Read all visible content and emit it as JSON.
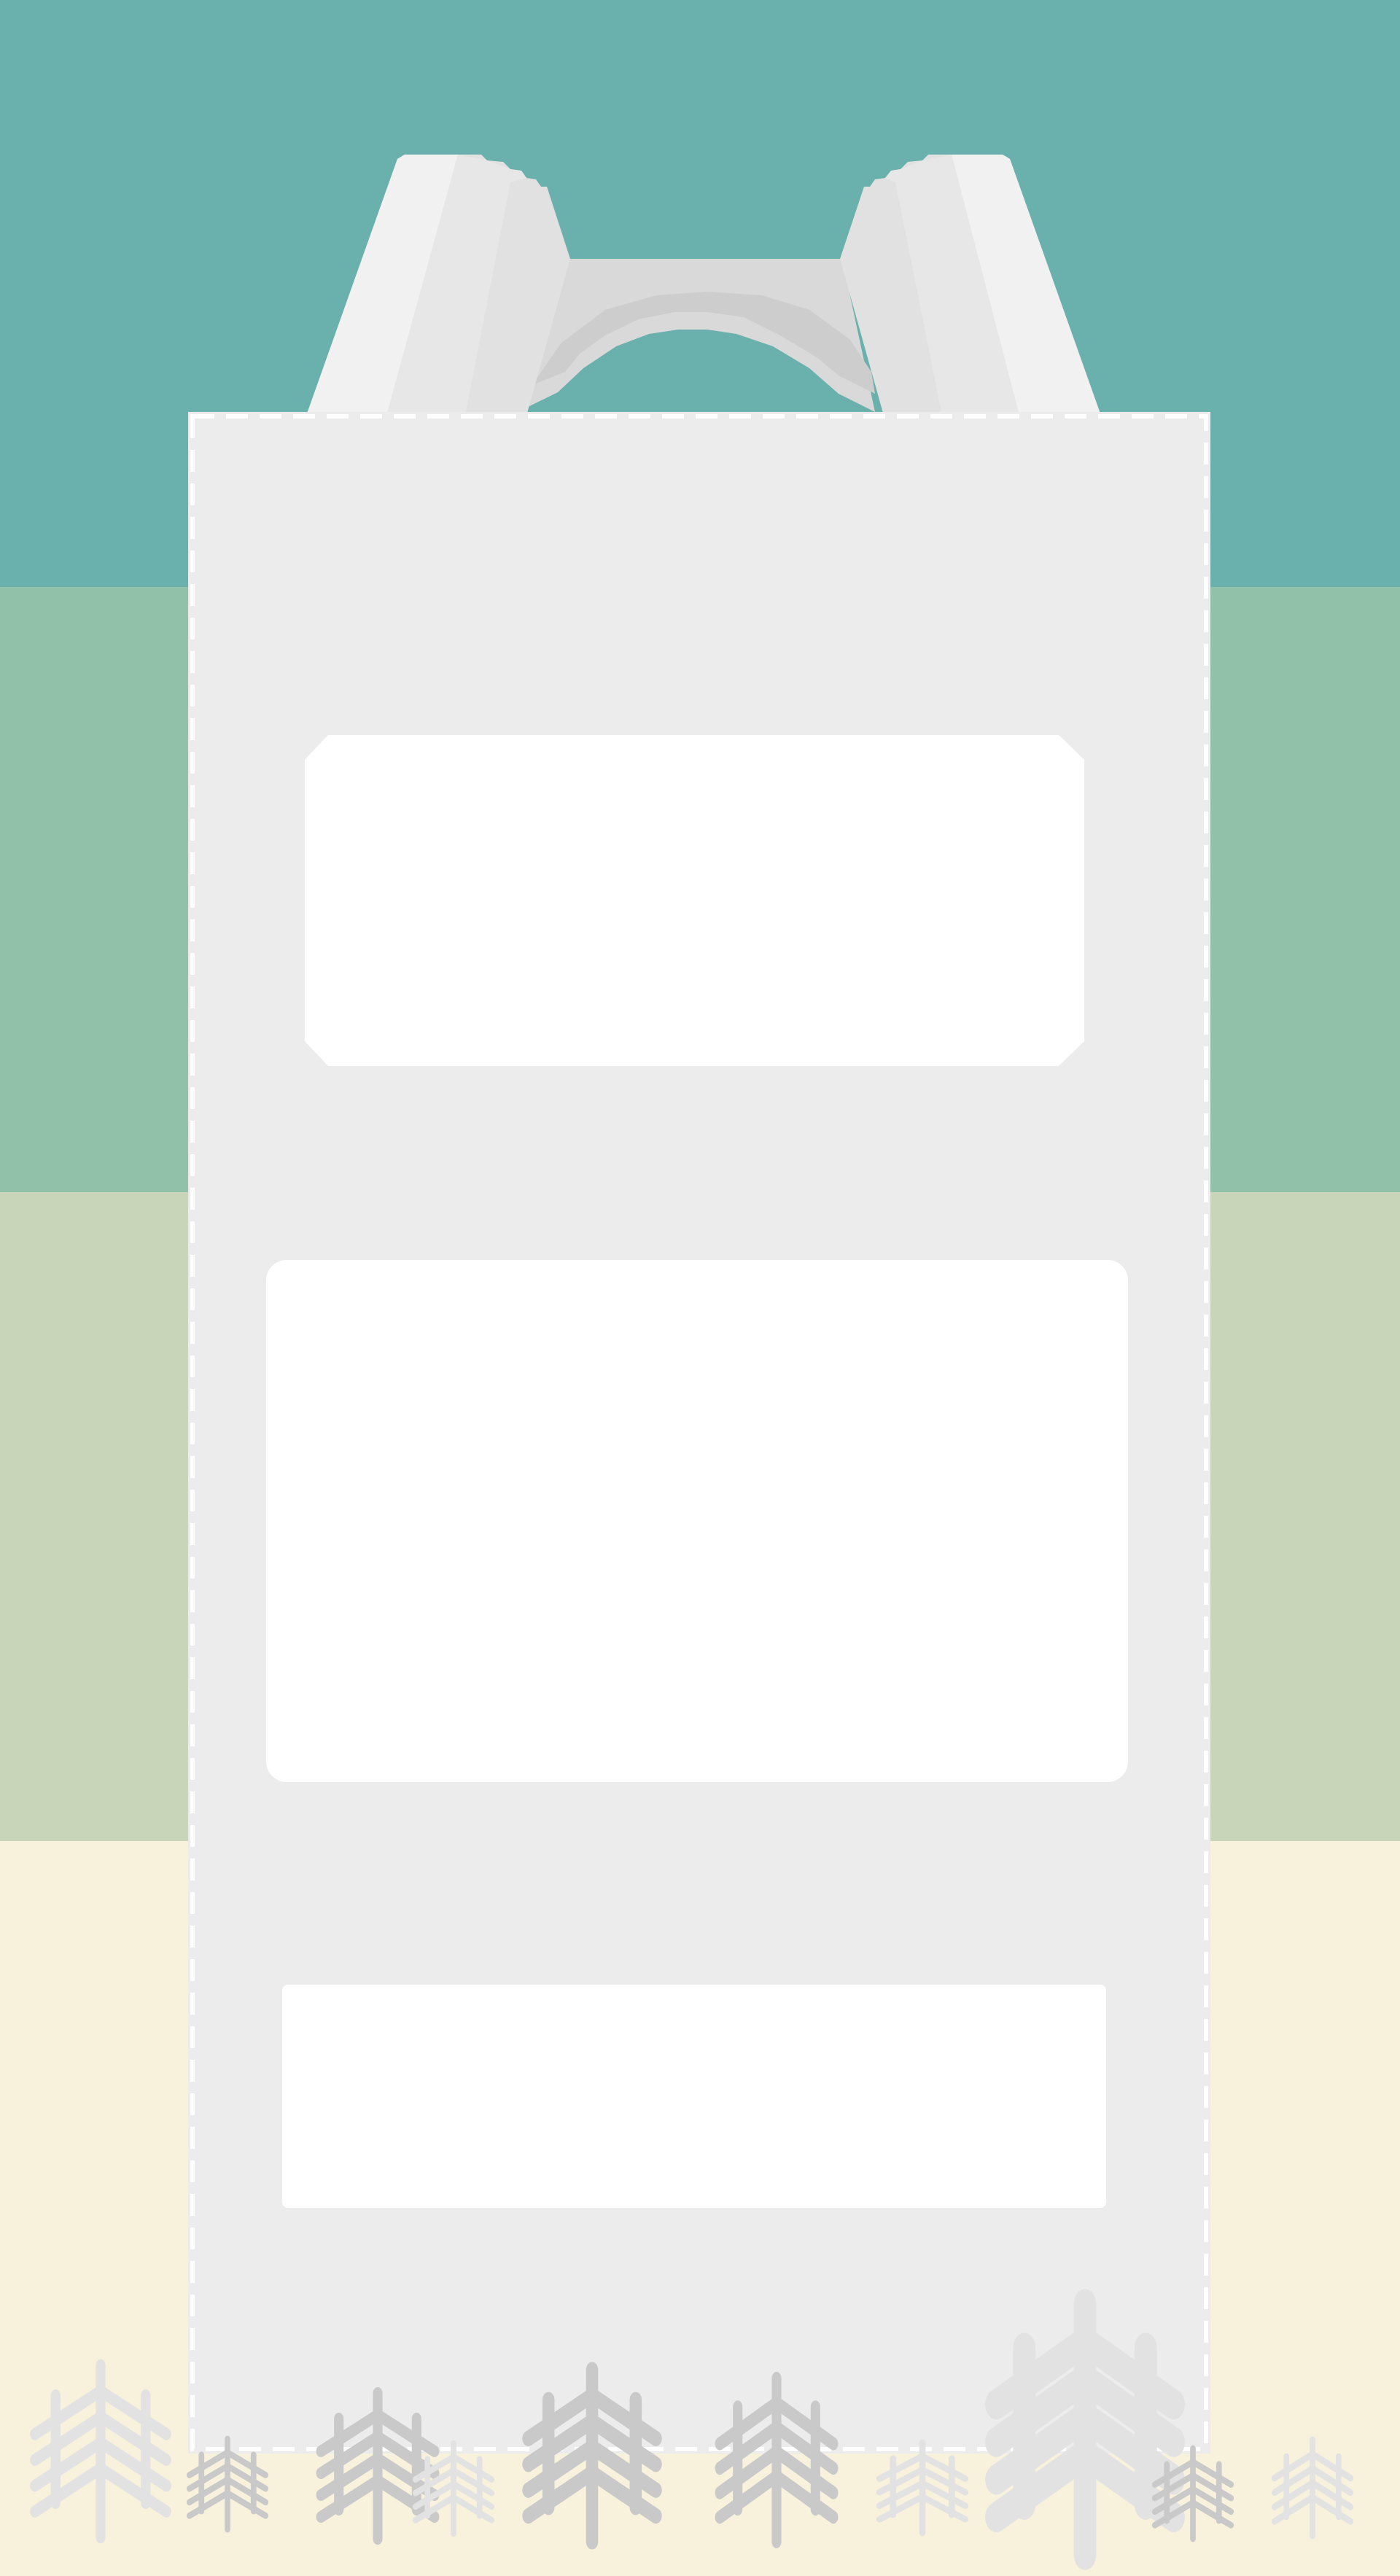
{
  "colors": {
    "band_top": "#6ab0ac",
    "band_second": "#92c1aa",
    "band_third": "#c8d5b9",
    "band_bottom": "#f8f2dc",
    "bag_body": "#ececec",
    "bag_stitch": "#ffffff",
    "strap_light": "#f1f1f1",
    "strap_mid": "#e7e7e7",
    "strap_dark": "#e1e1e1",
    "handle": "#d9d9d9",
    "handle_shadow": "#cdcdcd",
    "panel": "#ffffff",
    "tree_light": "#e2e2e2",
    "tree_dark": "#c9c9c9"
  },
  "icons": {
    "bag": "backpack-icon",
    "tree": "pine-tree-icon"
  }
}
